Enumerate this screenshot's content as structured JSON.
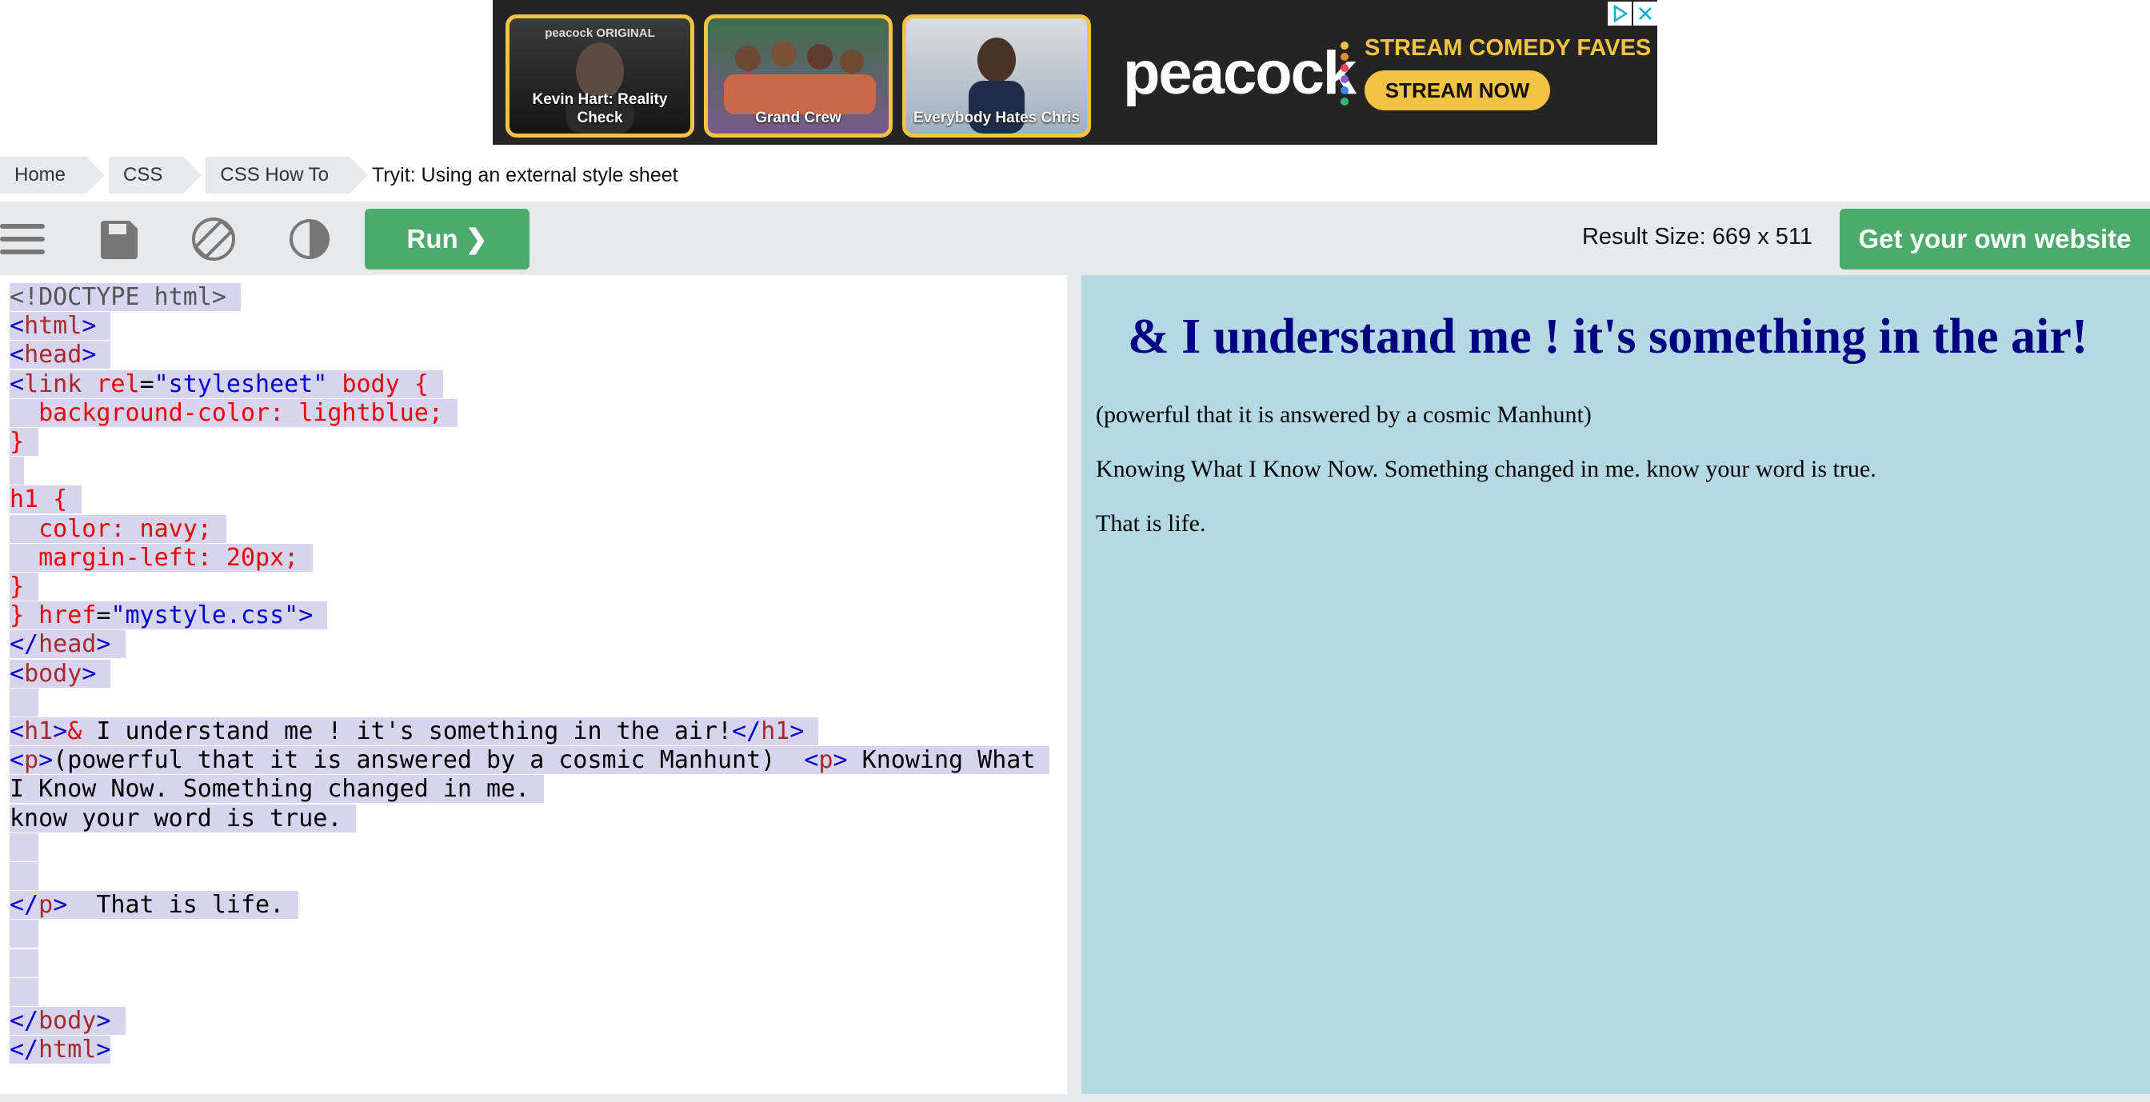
{
  "ad": {
    "cards": [
      {
        "tag": "peacock ORIGINAL",
        "title": "Kevin Hart: Reality Check"
      },
      {
        "tag": "",
        "title": "Grand Crew"
      },
      {
        "tag": "",
        "title": "Everybody Hates Chris"
      }
    ],
    "logo": "peacock",
    "headline": "STREAM COMEDY FAVES",
    "cta": "STREAM NOW",
    "brand_color": "#f5c343",
    "icons": [
      "adchoices-icon",
      "close-icon"
    ]
  },
  "breadcrumb": {
    "items": [
      "Home",
      "CSS",
      "CSS How To"
    ],
    "current": "Tryit: Using an external style sheet"
  },
  "toolbar": {
    "icons": [
      "menu-icon",
      "save-icon",
      "rotate-icon",
      "theme-icon"
    ],
    "run_label": "Run ❯",
    "result_size": "Result Size: 669 x 511",
    "own_website_label": "Get your own website",
    "accent_color": "#4caa6d"
  },
  "editor": {
    "lines": [
      "<!DOCTYPE html>",
      "<html>",
      "<head>",
      "<link rel=\"stylesheet\" body {",
      "  background-color: lightblue;",
      "}",
      "",
      "h1 {",
      "  color: navy;",
      "  margin-left: 20px;",
      "}",
      "} href=\"mystyle.css\">",
      "</head>",
      "<body>",
      "",
      "<h1>& I understand me ! it's something in the air!</h1>",
      "<p>(powerful that it is answered by a cosmic Manhunt)  <p> Knowing What",
      "I Know Now. Something changed in me.",
      "know your word is true.",
      "",
      "",
      "</p>  That is life.",
      "",
      "",
      "",
      "</body>",
      "</html>"
    ],
    "selection_color": "#d7d4f0"
  },
  "result": {
    "background": "#b4d8e4",
    "heading": "& I understand me ! it's something in the air!",
    "paragraphs": [
      "(powerful that it is answered by a cosmic Manhunt)",
      "Knowing What I Know Now. Something changed in me. know your word is true.",
      "That is life."
    ]
  }
}
